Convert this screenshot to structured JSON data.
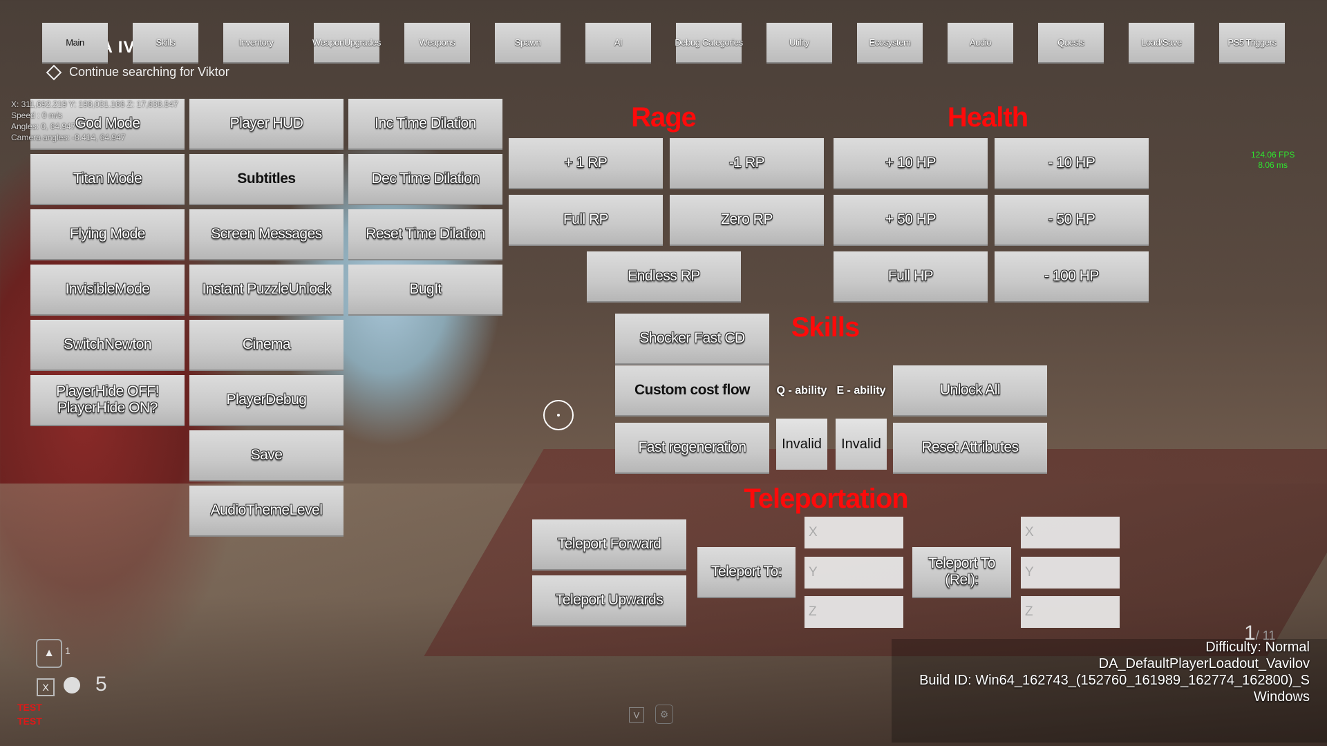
{
  "hud": {
    "objective_title": "WE DEA IVE PE",
    "objective": "Continue searching for Viktor",
    "debug_lines": [
      "X: 311,692.219 Y: 198,031.166 Z: 17,638.547",
      "Speed : 0 m/s",
      "Angles: 0, 64.947",
      "Camera angles: -8.414, 64.947"
    ],
    "fps": "124.06 FPS",
    "frame_ms": "8.06 ms",
    "ammo_count": "1",
    "ammo_total": "/ 11",
    "ability_count": "1",
    "item_count": "5",
    "item_key": "X",
    "test_labels": [
      "TEST",
      "TEST"
    ],
    "info_lines": [
      "Difficulty: Normal",
      "DA_DefaultPlayerLoadout_Vavilov",
      "Build ID: Win64_162743_(152760_161989_162774_162800)_S",
      "Windows"
    ],
    "bottom_key": "V",
    "colors": {
      "section_title": "#ff0a0a",
      "fps": "#2ee62e",
      "test": "#e01818"
    }
  },
  "tabs": [
    "Main",
    "Skills",
    "Inventory",
    "WeaponUpgrades",
    "Weapons",
    "Spawn",
    "AI",
    "Debug Categories",
    "Utility",
    "Ecosystem",
    "Audio",
    "Quests",
    "Load/Save",
    "PS5 Triggers"
  ],
  "active_tab": "Main",
  "main": {
    "col1": [
      "God Mode",
      "Titan Mode",
      "Flying Mode",
      "InvisibleMode",
      "SwitchNewton",
      "PlayerHide OFF!\nPlayerHide ON?"
    ],
    "col2": [
      "Player HUD",
      "Subtitles",
      "Screen Messages",
      "Instant PuzzleUnlock",
      "Cinema",
      "PlayerDebug",
      "Save",
      "AudioThemeLevel"
    ],
    "col3": [
      "Inc Time Dilation",
      "Dec Time Dilation",
      "Reset Time Dilation",
      "BugIt"
    ]
  },
  "rage": {
    "title": "Rage",
    "buttons": [
      "+ 1 RP",
      "-1 RP",
      "Full RP",
      "Zero RP",
      "Endless RP"
    ]
  },
  "health": {
    "title": "Health",
    "buttons": [
      "+ 10 HP",
      "- 10 HP",
      "+ 50 HP",
      "- 50 HP",
      "Full HP",
      "- 100 HP"
    ]
  },
  "skills": {
    "title": "Skills",
    "shocker": "Shocker Fast CD",
    "custom_cost": "Custom cost flow",
    "fast_regen": "Fast regeneration",
    "q_label": "Q - ability",
    "e_label": "E - ability",
    "q_value": "Invalid",
    "e_value": "Invalid",
    "unlock_all": "Unlock All",
    "reset_attributes": "Reset Attributes"
  },
  "teleport": {
    "title": "Teleportation",
    "forward": "Teleport Forward",
    "upwards": "Teleport Upwards",
    "to": "Teleport To:",
    "to_rel": "Teleport To (Rel):",
    "placeholders": [
      "X",
      "Y",
      "Z"
    ]
  }
}
